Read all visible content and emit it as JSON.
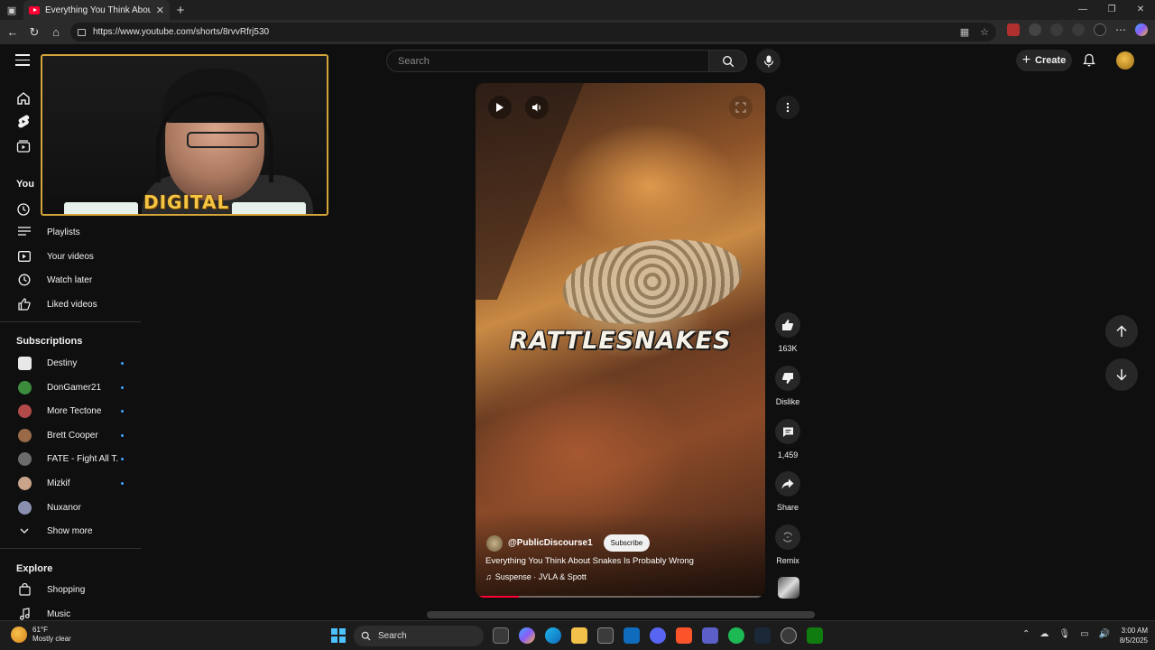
{
  "browser": {
    "tab_title": "Everything You Think About Snakes Is Probably Wrong",
    "url": "https://www.youtube.com/shorts/8rvvRfrj530"
  },
  "masthead": {
    "search_placeholder": "Search",
    "create_label": "Create"
  },
  "sidebar": {
    "you_heading": "You",
    "you_items": [
      {
        "label": "Playlists",
        "icon": "playlist-icon"
      },
      {
        "label": "Your videos",
        "icon": "your-videos-icon"
      },
      {
        "label": "Watch later",
        "icon": "clock-icon"
      },
      {
        "label": "Liked videos",
        "icon": "thumbs-up-icon"
      }
    ],
    "subscriptions_heading": "Subscriptions",
    "subscriptions": [
      {
        "label": "Destiny",
        "color": "#e8e8e8"
      },
      {
        "label": "DonGamer21",
        "color": "#3d8b3d"
      },
      {
        "label": "More Tectone",
        "color": "#b24a4a"
      },
      {
        "label": "Brett Cooper",
        "color": "#9a6a48"
      },
      {
        "label": "FATE - Fight All T...",
        "color": "#6b6b6b"
      },
      {
        "label": "Mizkif",
        "color": "#c9a48a"
      },
      {
        "label": "Nuxanor",
        "color": "#8a8fb0"
      }
    ],
    "show_more": "Show more",
    "explore_heading": "Explore",
    "explore_items": [
      {
        "label": "Shopping",
        "icon": "shopping-bag-icon"
      },
      {
        "label": "Music",
        "icon": "music-note-icon"
      }
    ]
  },
  "webcam": {
    "logo_text": "DIGITAL"
  },
  "short": {
    "overlay_text": "RATTLESNAKES",
    "channel_handle": "@PublicDiscourse1",
    "subscribe_label": "Subscribe",
    "title": "Everything You Think About Snakes Is Probably Wrong",
    "music": "Suspense · JVLA & Spott",
    "progress": 0.15
  },
  "actions": {
    "likes": "163K",
    "dislike_label": "Dislike",
    "comments": "1,459",
    "share_label": "Share",
    "remix_label": "Remix"
  },
  "taskbar": {
    "temperature": "61°F",
    "weather": "Mostly clear",
    "search_label": "Search",
    "time": "3:00 AM",
    "date": "8/5/2025"
  },
  "colors": {
    "accent_red": "#ff0033",
    "background": "#0f0f0f"
  }
}
